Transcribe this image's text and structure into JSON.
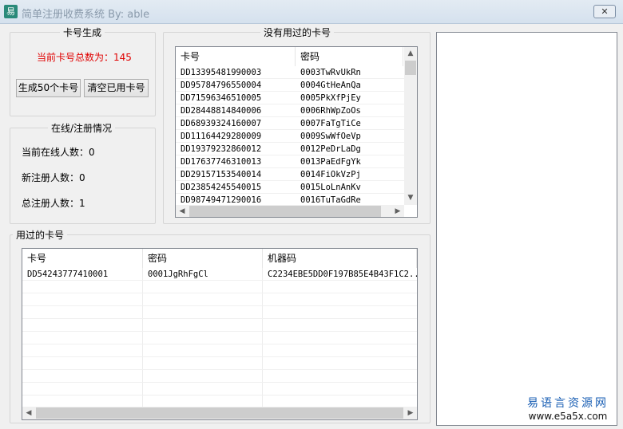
{
  "window": {
    "title": "简单注册收费系统  By: able",
    "close_icon": "close-icon"
  },
  "gen_group": {
    "title": "卡号生成",
    "total_label": "当前卡号总数为：145",
    "total_color": "#e00000",
    "generate_button": "生成50个卡号",
    "clear_button": "清空已用卡号"
  },
  "online_group": {
    "title": "在线/注册情况",
    "online": "当前在线人数：0",
    "new_reg": "新注册人数：0",
    "total_reg": "总注册人数：1"
  },
  "unused": {
    "title": "没有用过的卡号",
    "columns": [
      "卡号",
      "密码"
    ],
    "rows": [
      [
        "DD13395481990003",
        "0003TwRvUkRn"
      ],
      [
        "DD95784796550004",
        "0004GtHeAnQa"
      ],
      [
        "DD71596346510005",
        "0005PkXfPjEy"
      ],
      [
        "DD28448814840006",
        "0006RhWpZoOs"
      ],
      [
        "DD68939324160007",
        "0007FaTgTiCe"
      ],
      [
        "DD11164429280009",
        "0009SwWfOeVp"
      ],
      [
        "DD19379232860012",
        "0012PeDrLaDg"
      ],
      [
        "DD17637746310013",
        "0013PaEdFgYk"
      ],
      [
        "DD29157153540014",
        "0014FiOkVzPj"
      ],
      [
        "DD23854245540015",
        "0015LoLnAnKv"
      ],
      [
        "DD98749471290016",
        "0016TuTaGdRe"
      ]
    ]
  },
  "used": {
    "title": "用过的卡号",
    "columns": [
      "卡号",
      "密码",
      "机器码"
    ],
    "rows": [
      [
        "DD54243777410001",
        "0001JgRhFgCl",
        "C2234EBE5DD0F197B85E4B43F1C2..."
      ]
    ]
  },
  "watermark": {
    "line1": "易语言资源网",
    "line2": "www.e5a5x.com"
  }
}
